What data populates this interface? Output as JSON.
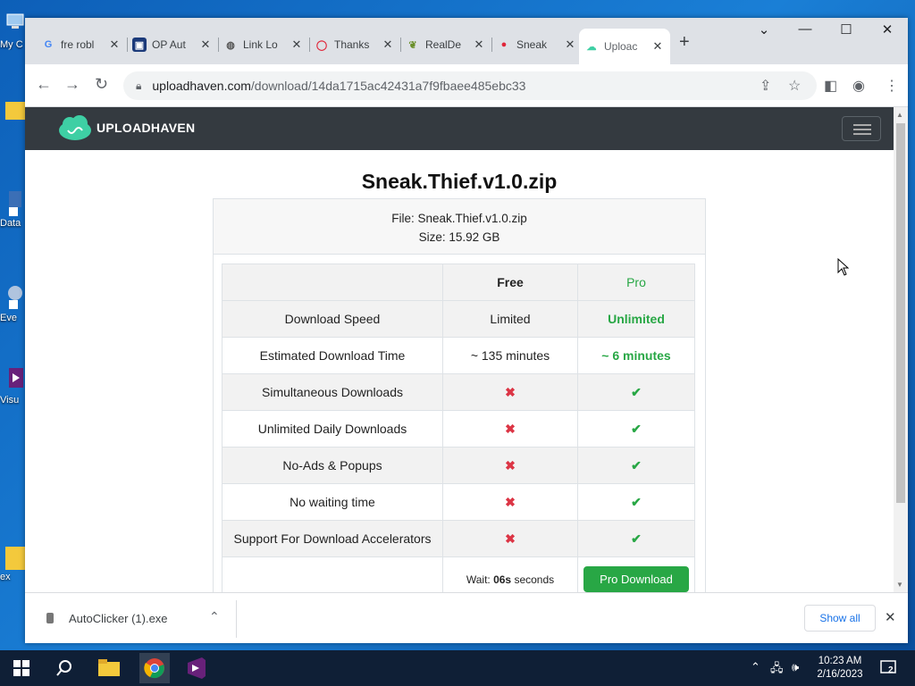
{
  "desktop": {
    "icons": [
      {
        "label": "My C",
        "icon": "computer-icon"
      },
      {
        "label": "",
        "icon": "folder-icon"
      },
      {
        "label": "Data",
        "icon": "shortcut-icon"
      },
      {
        "label": "Eve",
        "icon": "shortcut-icon"
      },
      {
        "label": "Visu",
        "icon": "visual-studio-icon"
      },
      {
        "label": "ex",
        "icon": "folder-icon"
      }
    ]
  },
  "browser": {
    "tabs": [
      {
        "title": "fre robl",
        "favicon": "google-icon"
      },
      {
        "title": "OP Aut",
        "favicon": "app-icon"
      },
      {
        "title": "Link Lo",
        "favicon": "globe-icon"
      },
      {
        "title": "Thanks",
        "favicon": "opera-icon"
      },
      {
        "title": "RealDe",
        "favicon": "leaf-icon"
      },
      {
        "title": "Sneak",
        "favicon": "game-icon"
      },
      {
        "title": "Uploac",
        "favicon": "uploadhaven-icon",
        "active": true
      }
    ],
    "url_domain": "uploadhaven.com",
    "url_path": "/download/14da1715ac42431a7f9fbaee485ebc33"
  },
  "site": {
    "logo_text": "UPLOADHAVEN",
    "file_title": "Sneak.Thief.v1.0.zip",
    "file_line": "File: Sneak.Thief.v1.0.zip",
    "size_line": "Size: 15.92 GB",
    "table": {
      "header": {
        "free": "Free",
        "pro": "Pro"
      },
      "rows": [
        {
          "feature": "Download Speed",
          "free": "Limited",
          "pro": "Unlimited"
        },
        {
          "feature": "Estimated Download Time",
          "free": "~ 135 minutes",
          "pro": "~ 6 minutes"
        },
        {
          "feature": "Simultaneous Downloads",
          "free": "✖",
          "pro": "✔"
        },
        {
          "feature": "Unlimited Daily Downloads",
          "free": "✖",
          "pro": "✔"
        },
        {
          "feature": "No-Ads & Popups",
          "free": "✖",
          "pro": "✔"
        },
        {
          "feature": "No waiting time",
          "free": "✖",
          "pro": "✔"
        },
        {
          "feature": "Support For Download Accelerators",
          "free": "✖",
          "pro": "✔"
        }
      ],
      "wait_prefix": "Wait: ",
      "wait_seconds": "06s",
      "wait_suffix": " seconds",
      "pro_button": "Pro Download"
    }
  },
  "download_shelf": {
    "file": "AutoClicker (1).exe",
    "show_all": "Show all"
  },
  "taskbar": {
    "time": "10:23 AM",
    "date": "2/16/2023",
    "notifications": "2"
  },
  "colors": {
    "site_header": "#343a40",
    "accent_green": "#28a745",
    "cross_red": "#dc3545",
    "taskbar": "#0f1f36"
  }
}
